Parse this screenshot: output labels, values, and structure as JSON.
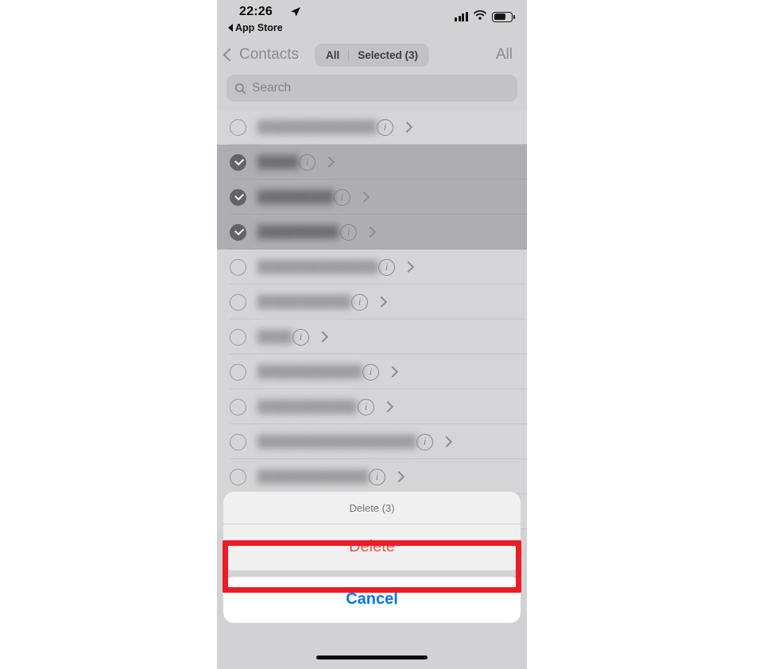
{
  "status_bar": {
    "time": "22:26",
    "location_icon": "location-arrow-icon",
    "back_app_label": "App Store",
    "signal_icon": "cellular-signal-icon",
    "wifi_icon": "wifi-icon",
    "battery_icon": "battery-icon"
  },
  "nav_bar": {
    "back_label": "Contacts",
    "back_icon": "chevron-left-icon",
    "segments": [
      {
        "label": "All"
      },
      {
        "label": "Selected (3)"
      }
    ],
    "right_label": "All"
  },
  "search": {
    "placeholder": "Search",
    "value": "",
    "icon": "search-icon"
  },
  "contacts": {
    "rows": [
      {
        "name": "",
        "selected": false,
        "bold": false,
        "blur_width": 150
      },
      {
        "name": "",
        "selected": true,
        "bold": false,
        "blur_width": 52
      },
      {
        "name": "",
        "selected": true,
        "bold": true,
        "blur_width": 96
      },
      {
        "name": "",
        "selected": true,
        "bold": true,
        "blur_width": 104
      },
      {
        "name": "",
        "selected": false,
        "bold": true,
        "blur_width": 152
      },
      {
        "name": "",
        "selected": false,
        "bold": true,
        "blur_width": 118
      },
      {
        "name": "",
        "selected": false,
        "bold": false,
        "blur_width": 44
      },
      {
        "name": "",
        "selected": false,
        "bold": true,
        "blur_width": 132
      },
      {
        "name": "",
        "selected": false,
        "bold": true,
        "blur_width": 126
      },
      {
        "name": "",
        "selected": false,
        "bold": true,
        "blur_width": 200
      },
      {
        "name": "",
        "selected": false,
        "bold": true,
        "blur_width": 140
      },
      {
        "name": "",
        "selected": false,
        "bold": true,
        "blur_width": 120
      }
    ],
    "info_icon": "info-icon",
    "disclosure_icon": "chevron-right-icon",
    "checkbox_icon": "checkbox-circle-icon"
  },
  "action_sheet": {
    "title": "Delete (3)",
    "delete_label": "Delete",
    "cancel_label": "Cancel"
  },
  "annotation": {
    "color": "#ec1c24",
    "target": "delete-button"
  },
  "colors": {
    "destructive": "#e8544c",
    "tint": "#0a75e8",
    "selected_row": "#aeaeb2",
    "list_bg": "#d5d5d7",
    "chrome_bg": "#d2d2d4"
  },
  "home_indicator": "home-indicator"
}
